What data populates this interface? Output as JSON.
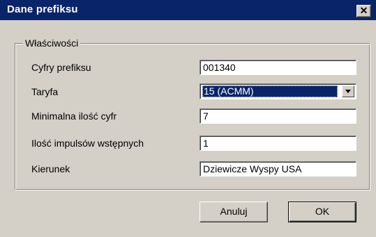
{
  "window": {
    "title": "Dane prefiksu",
    "close_glyph": "✕"
  },
  "group": {
    "legend": "Właściwości"
  },
  "fields": {
    "prefix_digits": {
      "label": "Cyfry prefiksu",
      "value": "001340"
    },
    "tariff": {
      "label": "Taryfa",
      "value": "15 (ACMM)"
    },
    "min_digits": {
      "label": "Minimalna ilość cyfr",
      "value": "7"
    },
    "initial_pulses": {
      "label": "Ilość impulsów wstępnych",
      "value": "1"
    },
    "direction": {
      "label": "Kierunek",
      "value": "Dziewicze Wyspy USA"
    }
  },
  "buttons": {
    "cancel": "Anuluj",
    "ok": "OK"
  },
  "colors": {
    "titlebar": "#0a246a",
    "face": "#d4d0c8",
    "selection": "#0a246a"
  }
}
